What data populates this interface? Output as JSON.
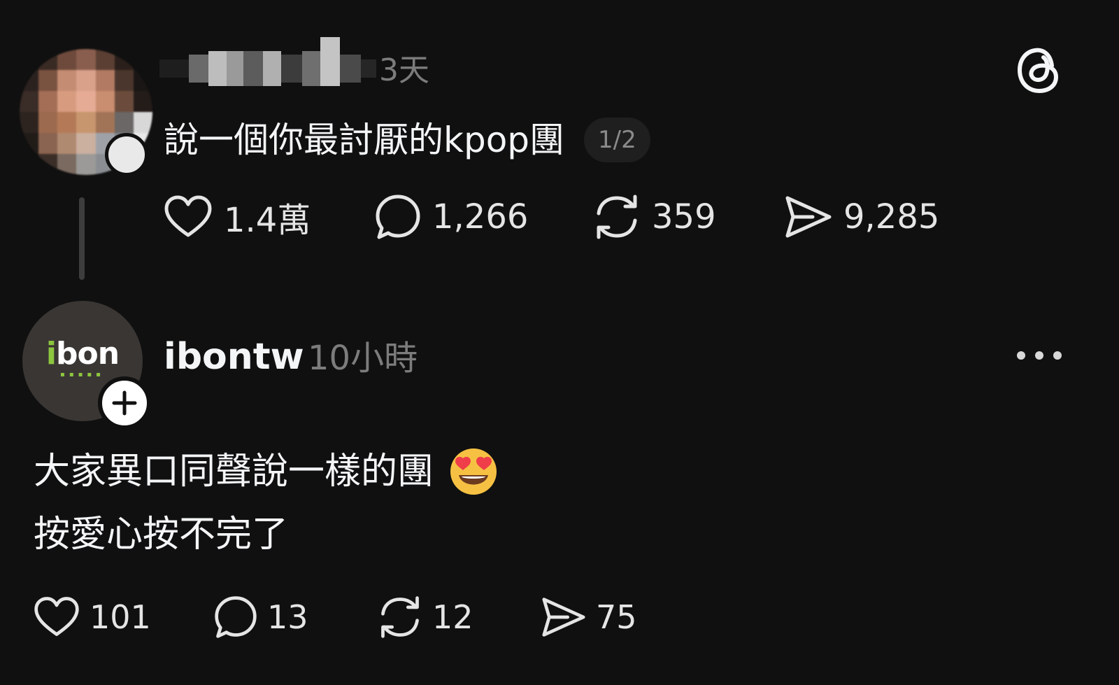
{
  "post1": {
    "avatar_icon": "blurred-avatar",
    "time": "3天",
    "text": "說一個你最討厭的kpop團",
    "page_indicator": "1/2",
    "actions": {
      "likes": "1.4萬",
      "comments": "1,266",
      "reposts": "359",
      "shares": "9,285"
    }
  },
  "app_icon": "threads-logo-icon",
  "post2": {
    "avatar_logo_text_i": "i",
    "avatar_logo_text_rest": "bon",
    "username": "ibontw",
    "time": "10小時",
    "text_line1": "大家異口同聲說一樣的團",
    "text_line2": "按愛心按不完了",
    "emoji": "smiling-face-with-heart-eyes",
    "actions": {
      "likes": "101",
      "comments": "13",
      "reposts": "12",
      "shares": "75"
    }
  },
  "colors": {
    "background": "#101010",
    "text": "#f3f5f7",
    "muted": "#7c7c7c",
    "brand_green": "#8dc63f"
  }
}
